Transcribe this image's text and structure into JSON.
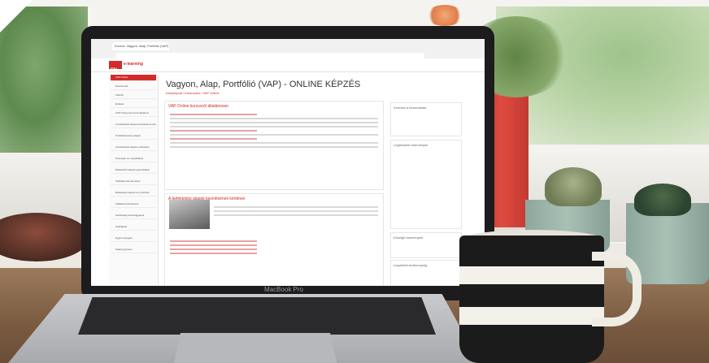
{
  "laptop": {
    "brand": "MacBook Pro",
    "browser": {
      "tab_title": "Kurzus: Vagyon, Alap, Portfólió (VAP)",
      "site_logo": "FN",
      "site_name": "e-learning",
      "page_title": "Vagyon, Alap, Portfólió (VAP) - ONLINE KÉPZÉS",
      "breadcrumb": "Irányítópult / Kurzusaim / VAP Online",
      "sidebar_items": [
        "VAP Online",
        "Résztvevők",
        "Kitűzők",
        "Értékek",
        "VAP Online kurzusról általános",
        "A befektetési alapok kezelésének kérdései",
        "Portfóliókezelés alapjai",
        "A befektetési alapok működése",
        "Szövegek és megoldások",
        "Befektetési alapok jogszabályai",
        "Szabályozott termékek",
        "Befektetési alapok és portfóliók",
        "Vállalati tanulmányok",
        "Gazdasági összefüggések",
        "Szabálytár",
        "Egyéb anyagok",
        "Saját jegyzetek"
      ],
      "sections": [
        {
          "title": "VAP Online kurzusról általánosan"
        },
        {
          "title": "A befektetési alapok kezelésének kérdései"
        }
      ],
      "right_cards": [
        {
          "title": "Keresés a fórumokban"
        },
        {
          "title": "Legfrissebb események"
        },
        {
          "title": "Közelgő események"
        },
        {
          "title": "Legutóbbi tevékenység"
        }
      ]
    }
  }
}
